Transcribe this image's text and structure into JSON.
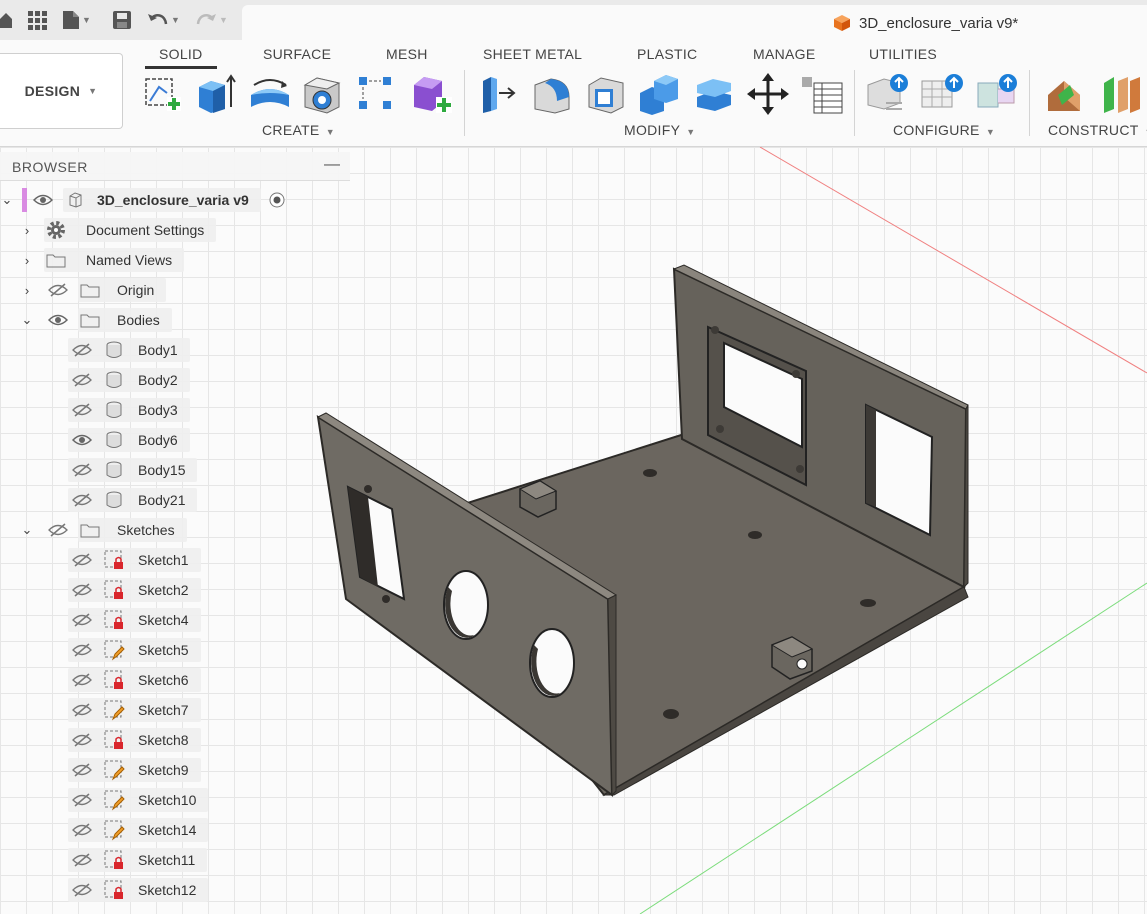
{
  "app": {
    "title": "3D_enclosure_varia v9*"
  },
  "workspace": {
    "label": "DESIGN"
  },
  "tabs": [
    "SOLID",
    "SURFACE",
    "MESH",
    "SHEET METAL",
    "PLASTIC",
    "MANAGE",
    "UTILITIES"
  ],
  "groups": {
    "create": "CREATE",
    "modify": "MODIFY",
    "configure": "CONFIGURE",
    "construct": "CONSTRUCT"
  },
  "browser": {
    "title": "BROWSER",
    "root": {
      "label": "3D_enclosure_varia v9"
    },
    "folders": {
      "document_settings": "Document Settings",
      "named_views": "Named Views",
      "origin": "Origin",
      "bodies": "Bodies",
      "sketches": "Sketches"
    },
    "bodies": [
      "Body1",
      "Body2",
      "Body3",
      "Body6",
      "Body15",
      "Body21"
    ],
    "sketches": [
      "Sketch1",
      "Sketch2",
      "Sketch4",
      "Sketch5",
      "Sketch6",
      "Sketch7",
      "Sketch8",
      "Sketch9",
      "Sketch10",
      "Sketch14",
      "Sketch11",
      "Sketch12"
    ]
  }
}
